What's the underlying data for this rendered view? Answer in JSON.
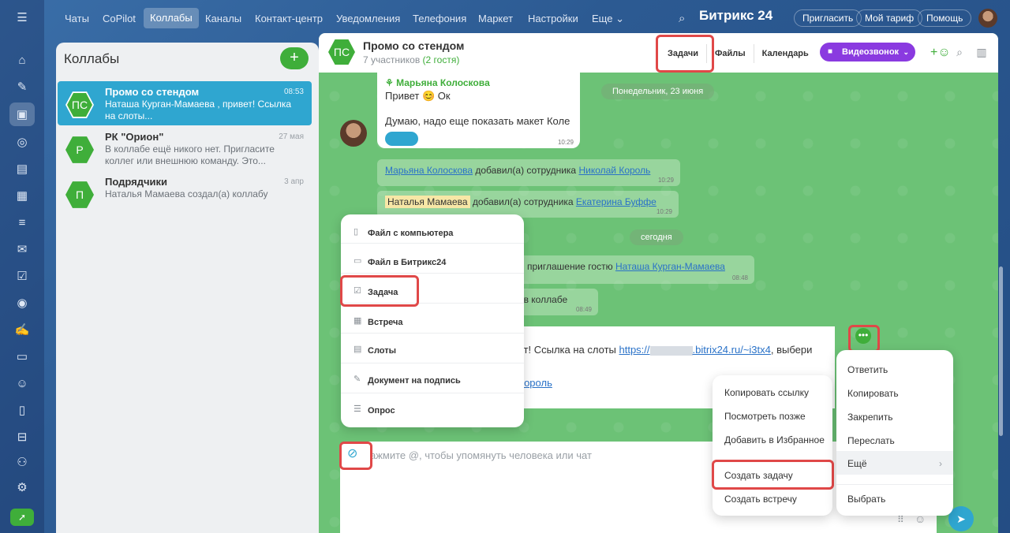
{
  "rail": {
    "icons": [
      "menu-icon",
      "home-icon",
      "tasks-icon",
      "chat-icon",
      "crm-icon",
      "docs-icon",
      "calendar-icon",
      "sites-icon",
      "mail-icon",
      "check-icon",
      "goals-icon",
      "sign-icon",
      "cards-icon",
      "team-icon",
      "files-icon",
      "shop-icon",
      "ai-icon",
      "settings-icon",
      "rocket-icon"
    ]
  },
  "topnav": {
    "items": [
      "Чаты",
      "CoPilot",
      "Коллабы",
      "Каналы",
      "Контакт-центр",
      "Уведомления",
      "Телефония",
      "Маркет",
      "Настройки",
      "Еще ⌄"
    ],
    "active": "Коллабы",
    "brand": "Битрикс 24",
    "buttons": [
      "Пригласить",
      "Мой тариф",
      "Помощь"
    ]
  },
  "sidebar": {
    "title": "Коллабы",
    "add": "+",
    "chats": [
      {
        "initials": "ПС",
        "name": "Промо со стендом",
        "time": "08:53",
        "preview": "Наташа Курган-Мамаева , привет! Ссылка на слоты..."
      },
      {
        "initials": "Р",
        "name": "РК \"Орион\"",
        "time": "27 мая",
        "preview": "В коллабе ещё никого нет. Пригласите коллег или внешнюю команду. Это..."
      },
      {
        "initials": "П",
        "name": "Подрядчики",
        "time": "3 апр",
        "preview": "Наталья Мамаева создал(а) коллабу"
      }
    ]
  },
  "chat": {
    "initials": "ПС",
    "title": "Промо со стендом",
    "participants": "7 участников",
    "guests": "(2 гостя)",
    "tabs": [
      "Задачи",
      "Файлы",
      "Календарь"
    ],
    "video": "Видеозвонок",
    "messages": {
      "author": "Марьяна Колосковa",
      "line1": "Привет 😊 Ок",
      "line2": "Думаю, надо еще показать макет Коле",
      "time1": "10:29",
      "date1": "Понедельник, 23 июня",
      "sys1_a": "Марьяна Колоскова",
      "sys1_b": " добавил(а) сотрудника ",
      "sys1_c": "Николай Король",
      "sys1_t": "10:29",
      "sys2_a": "Наталья Мамаева",
      "sys2_b": " добавил(а) сотрудника ",
      "sys2_c": "Екатерина Буффе",
      "sys2_t": "10:29",
      "date2": "сегодня",
      "sys3_b": "а) приглашение гостю ",
      "sys3_c": "Наташа Курган-Мамаева",
      "sys3_t": "08:48",
      "sys4_b": "ь в коллабе",
      "sys4_t": "08:49",
      "msg_text": "вет! Ссылка на слоты ",
      "msg_link": "https://",
      "msg_link2": ".bitrix24.ru/~i3tx4",
      "msg_tail": ", выбери",
      "msg_link3": "і Король"
    },
    "input_placeholder": "ажмите @, чтобы упомянуть человека или чат"
  },
  "attach_menu": [
    "Файл с компьютера",
    "Файл в Битрикс24",
    "Задача",
    "Встреча",
    "Слоты",
    "Документ на подпись",
    "Опрос"
  ],
  "context_menu": [
    "Ответить",
    "Копировать",
    "Закрепить",
    "Переслать",
    "Ещё",
    "Выбрать"
  ],
  "sub_menu": [
    "Копировать ссылку",
    "Посмотреть позже",
    "Добавить в Избранное",
    "Создать задачу",
    "Создать встречу"
  ]
}
